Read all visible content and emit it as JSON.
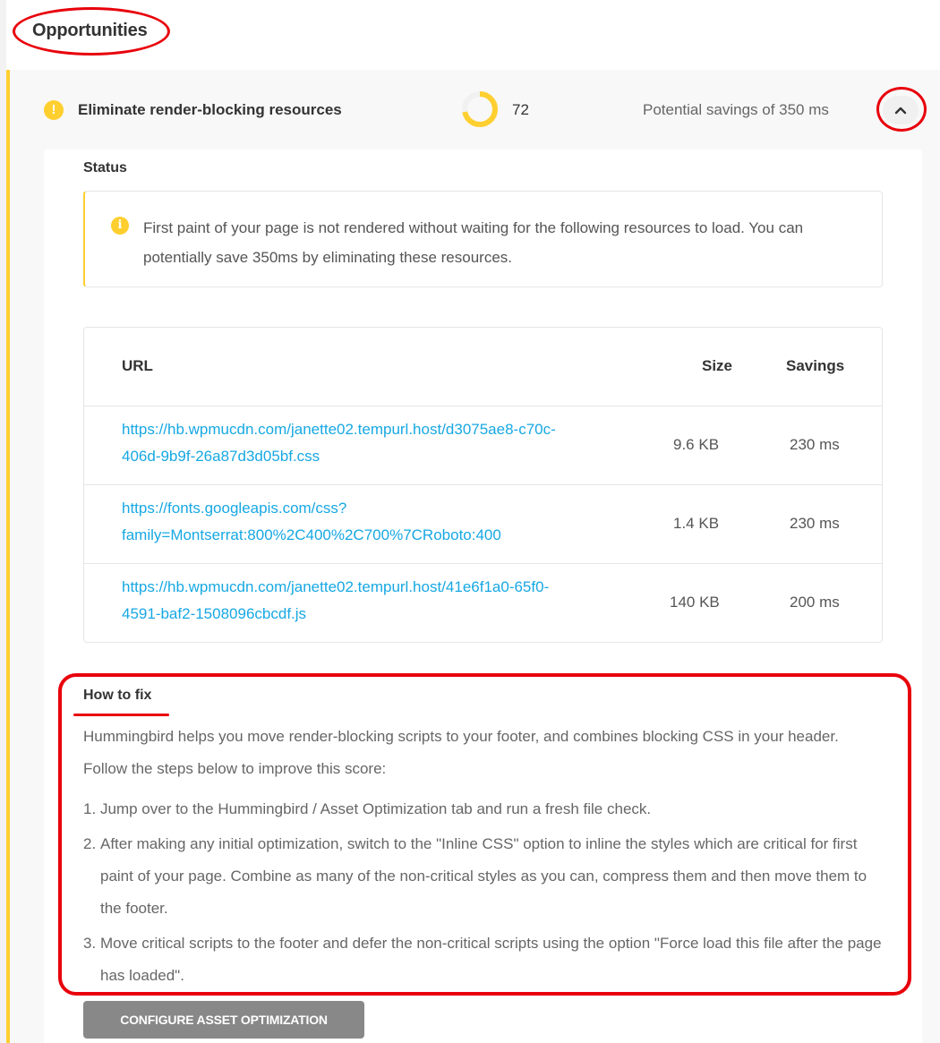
{
  "section": {
    "title": "Opportunities"
  },
  "opportunity": {
    "title": "Eliminate render-blocking resources",
    "score": "72",
    "score_fraction": 0.72,
    "savings": "Potential savings of 350 ms",
    "toggle_icon": "chevron-up-icon",
    "status_icon": "warning-icon"
  },
  "status": {
    "label": "Status",
    "notice_icon": "info-icon",
    "notice": "First paint of your page is not rendered without waiting for the following resources to load. You can potentially save 350ms by eliminating these resources."
  },
  "table": {
    "headers": {
      "url": "URL",
      "size": "Size",
      "savings": "Savings"
    },
    "rows": [
      {
        "url_line1": "https://hb.wpmucdn.com/janette02.tempurl.host/d3075ae8-c70c-",
        "url_line2": "406d-9b9f-26a87d3d05bf.css",
        "size": "9.6 KB",
        "savings": "230 ms"
      },
      {
        "url_line1": "https://fonts.googleapis.com/css?",
        "url_line2": "family=Montserrat:800%2C400%2C700%7CRoboto:400",
        "size": "1.4 KB",
        "savings": "230 ms"
      },
      {
        "url_line1": "https://hb.wpmucdn.com/janette02.tempurl.host/41e6f1a0-65f0-",
        "url_line2": "4591-baf2-1508096cbcdf.js",
        "size": "140 KB",
        "savings": "200 ms"
      }
    ]
  },
  "how_to_fix": {
    "label": "How to fix",
    "intro": "Hummingbird helps you move render-blocking scripts to your footer, and combines blocking CSS in your header. Follow the steps below to improve this score:",
    "steps": [
      {
        "num": "1.",
        "text": "Jump over to the Hummingbird / Asset Optimization tab and run a fresh file check."
      },
      {
        "num": "2.",
        "text": "After making any initial optimization, switch to the \"Inline CSS\" option to inline the styles which are critical for first paint of your page. Combine as many of the non-critical styles as you can, compress them and then move them to the footer."
      },
      {
        "num": "3.",
        "text": "Move critical scripts to the footer and defer the non-critical scripts using the option \"Force load this file after the page has loaded\"."
      }
    ]
  },
  "button": {
    "label": "CONFIGURE ASSET OPTIMIZATION"
  },
  "colors": {
    "accent_yellow": "#fecf2f",
    "link_blue": "#17a8e3",
    "annotation_red": "#e8000b",
    "button_gray": "#888888"
  }
}
